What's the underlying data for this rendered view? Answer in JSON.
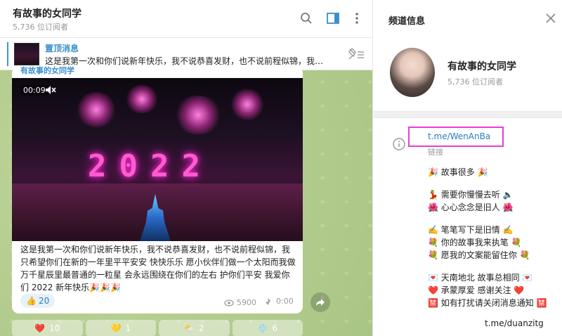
{
  "chat": {
    "title": "有故事的女同学",
    "subscribers": "5,736 位订阅者",
    "pinned": {
      "title": "置顶消息",
      "text": "这是我第一次和你们说新年快乐，我不说恭喜发财，也不说前程似锦，我…"
    },
    "message": {
      "sender": "有故事的女同学",
      "video_time": "00:09",
      "video_overlay": "2022",
      "text": "这是我第一次和你们说新年快乐，我不说恭喜发财，也不说前程似锦，我只希望你们在新的一年里平平安安 快快乐乐 愿小伙伴们做一个太阳而我做万千星辰里最普通的一粒星 会永远围绕在你们的左右 护你们平安 我爱你们 2022 新年快乐🎉🎉🎉",
      "reaction_emoji": "👍",
      "reaction_count": "20",
      "views": "5900",
      "time": "0:00"
    },
    "reactions": [
      {
        "emoji": "❤️",
        "count": "10"
      },
      {
        "emoji": "💛",
        "count": "1"
      },
      {
        "emoji": "⛅",
        "count": "2"
      },
      {
        "emoji": "❄️",
        "count": "6"
      }
    ]
  },
  "info": {
    "panel_title": "频道信息",
    "channel_name": "有故事的女同学",
    "subscribers": "5,736 位订阅者",
    "link": "t.me/WenAnBa",
    "link_label": "链接",
    "description": [
      "🎉 故事很多 🎉",
      "",
      "💃 需要你慢慢去听 🔈",
      "🌺 心心念念是旧人 🌺",
      "",
      "✍️ 笔笔写下是旧情 ✍️",
      "💐 你的故事我来执笔 💐",
      "💐 愿我的文案能留住你 💐",
      "",
      "💌 天南地北 故事总相同 💌",
      "❤️ 承蒙厚爱 感谢关注 ❤️",
      "🈲 如有打扰请关闭消息通知 🈲"
    ],
    "footer_link": "t.me/duanzitg"
  }
}
